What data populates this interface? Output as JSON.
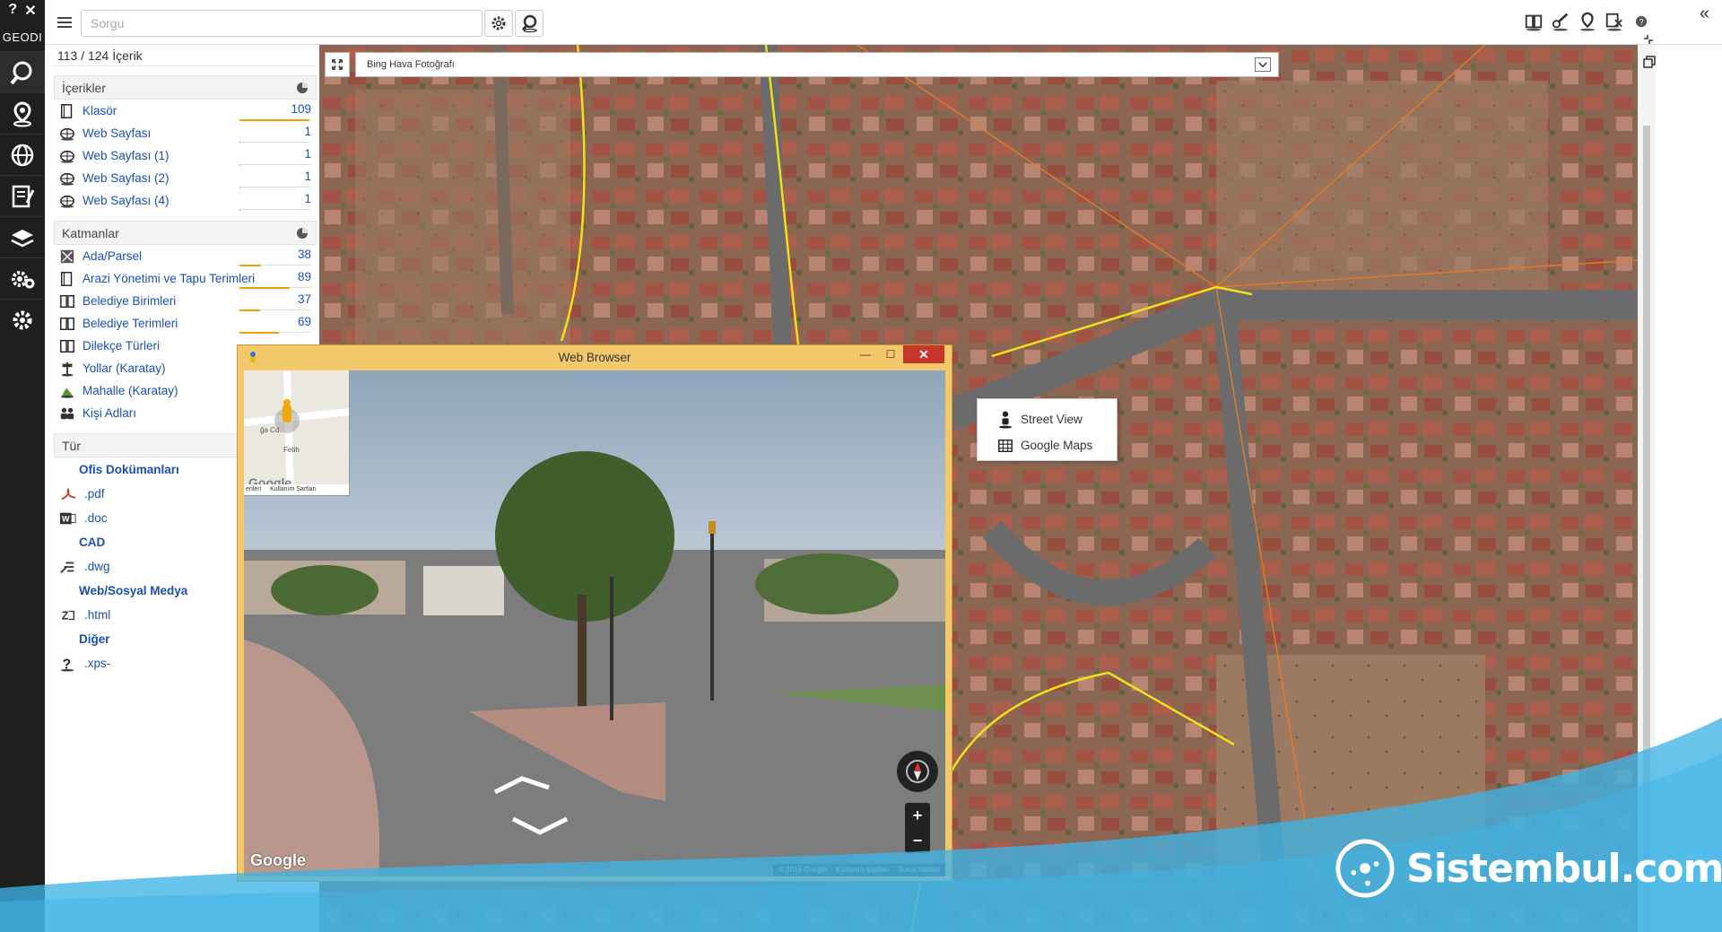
{
  "rail": {
    "help": "?",
    "close": "✕",
    "brand": "GEODI",
    "buttons": [
      "search-icon",
      "location-pin-icon",
      "globe-icon",
      "notes-icon",
      "layers-icon",
      "settings-gears-icon",
      "gear-icon"
    ]
  },
  "topbar": {
    "search_placeholder": "Sorgu",
    "collapse": "«"
  },
  "left_panel": {
    "result_count": "113 / 124 İçerik",
    "contents": {
      "title": "İçerikler",
      "items": [
        {
          "label": "Klasör",
          "count": "109",
          "fill": 0.98
        },
        {
          "label": "Web Sayfası",
          "count": "1",
          "fill": 0.01
        },
        {
          "label": "Web Sayfası (1)",
          "count": "1",
          "fill": 0.01
        },
        {
          "label": "Web Sayfası (2)",
          "count": "1",
          "fill": 0.01
        },
        {
          "label": "Web Sayfası (4)",
          "count": "1",
          "fill": 0.01
        }
      ]
    },
    "layers": {
      "title": "Katmanlar",
      "items": [
        {
          "label": "Ada/Parsel",
          "count": "38",
          "fill": 0.3
        },
        {
          "label": "Arazi Yönetimi ve Tapu Terimleri",
          "count": "89",
          "fill": 0.7
        },
        {
          "label": "Belediye Birimleri",
          "count": "37",
          "fill": 0.29
        },
        {
          "label": "Belediye Terimleri",
          "count": "69",
          "fill": 0.55
        },
        {
          "label": "Dilekçe Türleri",
          "count": "",
          "fill": 0.2
        },
        {
          "label": "Yollar (Karatay)",
          "count": "",
          "fill": 0
        },
        {
          "label": "Mahalle (Karatay)",
          "count": "",
          "fill": 0
        },
        {
          "label": "Kişi Adları",
          "count": "",
          "fill": 0
        }
      ]
    },
    "types": {
      "title": "Tür",
      "groups": [
        {
          "name": "Ofis Dokümanları",
          "items": [
            ".pdf",
            ".doc"
          ]
        },
        {
          "name": "CAD",
          "items": [
            ".dwg"
          ]
        },
        {
          "name": "Web/Sosyal Medya",
          "items": [
            ".html"
          ]
        },
        {
          "name": "Diğer",
          "items": [
            ".xps-"
          ]
        }
      ]
    }
  },
  "map": {
    "basemap": "Bing Hava Fotoğrafı"
  },
  "context_menu": {
    "items": [
      "Street View",
      "Google Maps"
    ]
  },
  "web_browser": {
    "title": "Web Browser",
    "minimize": "—",
    "maximize": "☐",
    "close": "✕",
    "minimap_street_1": "ğa Cd.",
    "minimap_street_2": "Fetih",
    "minimap_google": "Google",
    "minimap_footer_1": "erileri",
    "minimap_footer_2": "Kullanım Şartları",
    "zoom_in": "+",
    "zoom_out": "−",
    "google_logo": "Google",
    "footer_1": "© 2016 Google",
    "footer_2": "Kullanım Şartları",
    "footer_3": "Sorun bildirin"
  },
  "watermark": {
    "text": "Sistembul.com"
  },
  "colors": {
    "rail_bg": "#1f1f1f",
    "link": "#1a4fb5",
    "bar": "#f0a000",
    "window_frame": "#f3c86a",
    "close_red": "#c7352c",
    "watermark_blue": "#3db3e6"
  }
}
